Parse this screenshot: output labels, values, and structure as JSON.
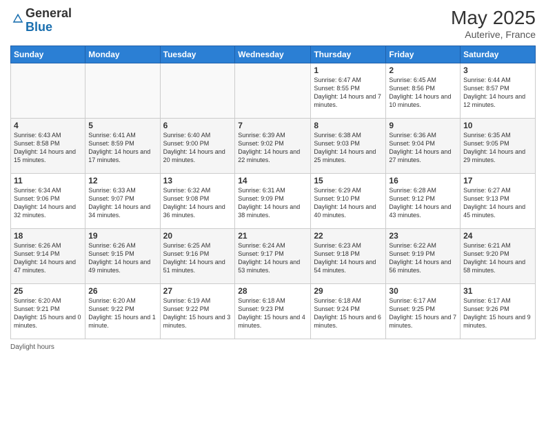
{
  "header": {
    "logo_general": "General",
    "logo_blue": "Blue",
    "month": "May 2025",
    "location": "Auterive, France"
  },
  "days_of_week": [
    "Sunday",
    "Monday",
    "Tuesday",
    "Wednesday",
    "Thursday",
    "Friday",
    "Saturday"
  ],
  "weeks": [
    [
      {
        "num": "",
        "info": ""
      },
      {
        "num": "",
        "info": ""
      },
      {
        "num": "",
        "info": ""
      },
      {
        "num": "",
        "info": ""
      },
      {
        "num": "1",
        "info": "Sunrise: 6:47 AM\nSunset: 8:55 PM\nDaylight: 14 hours and 7 minutes."
      },
      {
        "num": "2",
        "info": "Sunrise: 6:45 AM\nSunset: 8:56 PM\nDaylight: 14 hours and 10 minutes."
      },
      {
        "num": "3",
        "info": "Sunrise: 6:44 AM\nSunset: 8:57 PM\nDaylight: 14 hours and 12 minutes."
      }
    ],
    [
      {
        "num": "4",
        "info": "Sunrise: 6:43 AM\nSunset: 8:58 PM\nDaylight: 14 hours and 15 minutes."
      },
      {
        "num": "5",
        "info": "Sunrise: 6:41 AM\nSunset: 8:59 PM\nDaylight: 14 hours and 17 minutes."
      },
      {
        "num": "6",
        "info": "Sunrise: 6:40 AM\nSunset: 9:00 PM\nDaylight: 14 hours and 20 minutes."
      },
      {
        "num": "7",
        "info": "Sunrise: 6:39 AM\nSunset: 9:02 PM\nDaylight: 14 hours and 22 minutes."
      },
      {
        "num": "8",
        "info": "Sunrise: 6:38 AM\nSunset: 9:03 PM\nDaylight: 14 hours and 25 minutes."
      },
      {
        "num": "9",
        "info": "Sunrise: 6:36 AM\nSunset: 9:04 PM\nDaylight: 14 hours and 27 minutes."
      },
      {
        "num": "10",
        "info": "Sunrise: 6:35 AM\nSunset: 9:05 PM\nDaylight: 14 hours and 29 minutes."
      }
    ],
    [
      {
        "num": "11",
        "info": "Sunrise: 6:34 AM\nSunset: 9:06 PM\nDaylight: 14 hours and 32 minutes."
      },
      {
        "num": "12",
        "info": "Sunrise: 6:33 AM\nSunset: 9:07 PM\nDaylight: 14 hours and 34 minutes."
      },
      {
        "num": "13",
        "info": "Sunrise: 6:32 AM\nSunset: 9:08 PM\nDaylight: 14 hours and 36 minutes."
      },
      {
        "num": "14",
        "info": "Sunrise: 6:31 AM\nSunset: 9:09 PM\nDaylight: 14 hours and 38 minutes."
      },
      {
        "num": "15",
        "info": "Sunrise: 6:29 AM\nSunset: 9:10 PM\nDaylight: 14 hours and 40 minutes."
      },
      {
        "num": "16",
        "info": "Sunrise: 6:28 AM\nSunset: 9:12 PM\nDaylight: 14 hours and 43 minutes."
      },
      {
        "num": "17",
        "info": "Sunrise: 6:27 AM\nSunset: 9:13 PM\nDaylight: 14 hours and 45 minutes."
      }
    ],
    [
      {
        "num": "18",
        "info": "Sunrise: 6:26 AM\nSunset: 9:14 PM\nDaylight: 14 hours and 47 minutes."
      },
      {
        "num": "19",
        "info": "Sunrise: 6:26 AM\nSunset: 9:15 PM\nDaylight: 14 hours and 49 minutes."
      },
      {
        "num": "20",
        "info": "Sunrise: 6:25 AM\nSunset: 9:16 PM\nDaylight: 14 hours and 51 minutes."
      },
      {
        "num": "21",
        "info": "Sunrise: 6:24 AM\nSunset: 9:17 PM\nDaylight: 14 hours and 53 minutes."
      },
      {
        "num": "22",
        "info": "Sunrise: 6:23 AM\nSunset: 9:18 PM\nDaylight: 14 hours and 54 minutes."
      },
      {
        "num": "23",
        "info": "Sunrise: 6:22 AM\nSunset: 9:19 PM\nDaylight: 14 hours and 56 minutes."
      },
      {
        "num": "24",
        "info": "Sunrise: 6:21 AM\nSunset: 9:20 PM\nDaylight: 14 hours and 58 minutes."
      }
    ],
    [
      {
        "num": "25",
        "info": "Sunrise: 6:20 AM\nSunset: 9:21 PM\nDaylight: 15 hours and 0 minutes."
      },
      {
        "num": "26",
        "info": "Sunrise: 6:20 AM\nSunset: 9:22 PM\nDaylight: 15 hours and 1 minute."
      },
      {
        "num": "27",
        "info": "Sunrise: 6:19 AM\nSunset: 9:22 PM\nDaylight: 15 hours and 3 minutes."
      },
      {
        "num": "28",
        "info": "Sunrise: 6:18 AM\nSunset: 9:23 PM\nDaylight: 15 hours and 4 minutes."
      },
      {
        "num": "29",
        "info": "Sunrise: 6:18 AM\nSunset: 9:24 PM\nDaylight: 15 hours and 6 minutes."
      },
      {
        "num": "30",
        "info": "Sunrise: 6:17 AM\nSunset: 9:25 PM\nDaylight: 15 hours and 7 minutes."
      },
      {
        "num": "31",
        "info": "Sunrise: 6:17 AM\nSunset: 9:26 PM\nDaylight: 15 hours and 9 minutes."
      }
    ]
  ],
  "footer": {
    "daylight_label": "Daylight hours"
  }
}
